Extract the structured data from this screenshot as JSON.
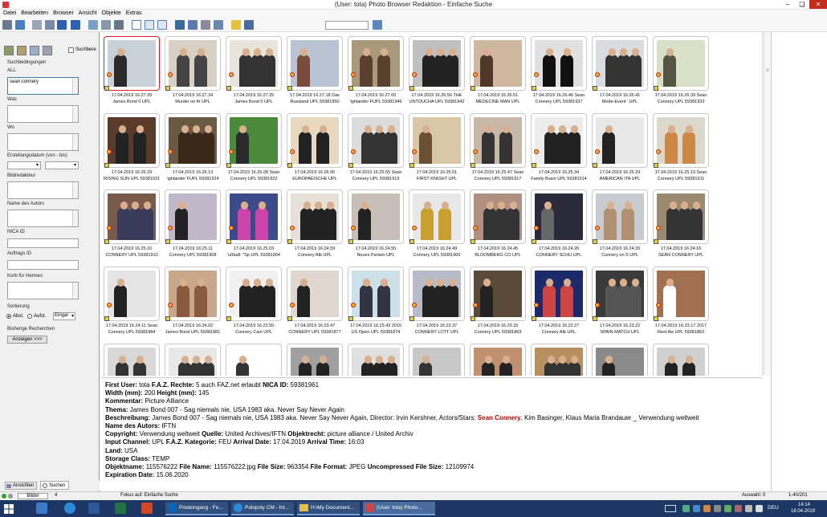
{
  "window": {
    "title": "(User: tota) Photo Browser Redaktion - Einfache Suche"
  },
  "menu": [
    "Datei",
    "Bearbeiten",
    "Browser",
    "Ansicht",
    "Objekte",
    "Extras"
  ],
  "search": {
    "chk_label": "Suchbere",
    "conditions_label": "Suchbedingungen",
    "all_label": "ALL",
    "all_value": "sean connery",
    "was": "Was",
    "wo": "Wo",
    "date": "Erstellungsdatum (von - bis)",
    "bildred": "Bildredakteur",
    "autor": "Name des Autors",
    "nica": "NICA ID",
    "auftrag": "Auftrags ID",
    "korb": "Korb für Hermes",
    "sort": "Sortierung",
    "abst": "Abst.",
    "aufst": "Aufst.",
    "eingang": "Eingar",
    "bisherige": "Bisherige Recherchen",
    "anzeigen": "Anzeigen >>>"
  },
  "tabs": {
    "ansichten": "Ansichten",
    "suchen": "Suchen"
  },
  "tiles": [
    {
      "d": "17.04.2019 16.27.39",
      "t": "James Bond 0 UPL"
    },
    {
      "d": "17.04.2019 16.27.34",
      "t": "Murder on th UPL"
    },
    {
      "d": "17.04.2019 16.27.25",
      "t": "James Bond 0 UPL"
    },
    {
      "d": "17.04.2019 16.27.18 Das",
      "t": "Russland UPL 59381950"
    },
    {
      "d": "17.04.2019 16.27.00",
      "t": "'ighlander FUPL 59381946"
    },
    {
      "d": "17.04.2019 16.26.56 THE",
      "t": "UNTOUCHA UPL 59381942"
    },
    {
      "d": "17.04.2019 16.26.51",
      "t": "MEDECINE MAN UPL"
    },
    {
      "d": "17.04.2019 16.26.46 Sean",
      "t": "Connery UPL 59381937"
    },
    {
      "d": "17.04.2019 16.26.41",
      "t": "Mode-Event ' UPL"
    },
    {
      "d": "17.04.2019 16.26.39 Sean",
      "t": "Connery UPL 59381933"
    },
    {
      "d": "17.04.2019 16.26.29",
      "t": "RISING SUN UPL 59381931"
    },
    {
      "d": "17.04.2019 16.26.13",
      "t": "'ighlander FUPL 59381924"
    },
    {
      "d": "17.04.2019 16.26.08 Sean",
      "t": "Connery UPL 59381922"
    },
    {
      "d": "17.04.2019 16.26.06",
      "t": "EUROPAEISCHE UPL"
    },
    {
      "d": "17.04.2019 16.25.55 Sean",
      "t": "Connery UPL 59381919"
    },
    {
      "d": "17.04.2019 16.25.51",
      "t": "FIRST KNIGHT UPL"
    },
    {
      "d": "17.04.2019 16.25.47 Sean",
      "t": "Connery UPL 59381917"
    },
    {
      "d": "17.04.2019 16.25.34",
      "t": "Family Busin UPL 59381914"
    },
    {
      "d": "17.04.2019 16.25.29",
      "t": "AMERICAN ITA UPL"
    },
    {
      "d": "17.04.2019 16.25.19 Sean",
      "t": "Connery UPL 59381911"
    },
    {
      "d": "17.04.2019 16.25.16",
      "t": "CONNERY UPL 59381910"
    },
    {
      "d": "17.04.2019 16.25.11",
      "t": "Connery UPL 59381908"
    },
    {
      "d": "17.04.2019 16.25.03",
      "t": "'ußball: \"Sp UPL 59381904"
    },
    {
      "d": "17.04.2019 16.24.59",
      "t": "Connery Alb UPL"
    },
    {
      "d": "17.04.2019 16.24.55",
      "t": "Neues Parlam UPL"
    },
    {
      "d": "17.04.2019 16.24.49",
      "t": "Connery UPL 59381900"
    },
    {
      "d": "17.04.2019 16.24.45",
      "t": "BLOOMBERG CO UPL"
    },
    {
      "d": "17.04.2019 16.24.26",
      "t": "CONNERY SCHU UPL"
    },
    {
      "d": "17.04.2019 16.24.20",
      "t": "Connery on S UPL"
    },
    {
      "d": "17.04.2019 16.24.16",
      "t": "SEAN CONNERY UPL"
    },
    {
      "d": "17.04.2019 16.24.11 Sean",
      "t": "Connery UPL 59381884"
    },
    {
      "d": "17.04.2019 16.24.02",
      "t": "James Bond UPL 59381881"
    },
    {
      "d": "17.04.2019 16.23.55",
      "t": "Connery Cain UPL"
    },
    {
      "d": "17.04.2019 16.23.47",
      "t": "CONNERY UPL 59381877"
    },
    {
      "d": "17.04.2019 16.23.43 2015",
      "t": "US Open UPL 59381874"
    },
    {
      "d": "17.04.2019 16.23.37",
      "t": "CONNERY LOTT UPL"
    },
    {
      "d": "17.04.2019 16.23.33",
      "t": "Connery UPL 59381869"
    },
    {
      "d": "17.04.2019 16.23.27",
      "t": "Connery Alb UPL"
    },
    {
      "d": "17.04.2019 16.23.22",
      "t": "SPAIN MATCH UPL"
    },
    {
      "d": "17.04.2019 16.23.17 2017",
      "t": "Reel Aw UPL 59381863"
    },
    {
      "d": "",
      "t": ""
    },
    {
      "d": "",
      "t": ""
    },
    {
      "d": "",
      "t": ""
    },
    {
      "d": "",
      "t": ""
    },
    {
      "d": "",
      "t": ""
    },
    {
      "d": "",
      "t": ""
    },
    {
      "d": "",
      "t": ""
    },
    {
      "d": "",
      "t": ""
    },
    {
      "d": "",
      "t": ""
    },
    {
      "d": "",
      "t": ""
    }
  ],
  "details": {
    "first_user_l": "First User:",
    "first_user": "tota",
    "rechte_l": "F.A.Z. Rechte:",
    "rechte": "5 auch FAZ.net erlaubt",
    "nica_l": "NICA ID:",
    "nica": "59381961",
    "width_l": "Width (mm):",
    "width": "200",
    "height_l": "Height (mm):",
    "height": "145",
    "komm_l": "Kommentar:",
    "komm": "Picture Alliance",
    "thema_l": "Thema:",
    "thema": "James Bond 007 - Sag niemals nie, USA 1983 aka. Never Say Never Again",
    "beschr_l": "Beschreibung:",
    "beschr_a": "James Bond 007 - Sag niemals nie, USA 1983 aka. Never Say Never Again, Director: Irvin Kershner, Actors/Stars:",
    "beschr_hl": "Sean Connery",
    "beschr_b": ", Kim Basinger, Klaus Maria Brandauer _ Verwendung weltweit",
    "autor_l": "Name des Autors:",
    "autor": "IFTN",
    "copy_l": "Copyright:",
    "copy": "Verwendung weltweit",
    "quelle_l": "Quelle:",
    "quelle": "United Archives/IFTN",
    "obj_l": "Objektrecht:",
    "obj": "picture alliance / United Archiv",
    "input_l": "Input Channel:",
    "input": "UPL",
    "kat_l": "F.A.Z. Kategorie:",
    "kat": "FEU",
    "arr_l": "Arrival Date:",
    "arr": "17.04.2019",
    "arrt_l": "Arrival Time:",
    "arrt": "16:03",
    "land_l": "Land:",
    "land": "USA",
    "storage_l": "Storage Class:",
    "storage": "TEMP",
    "objname_l": "Objektname:",
    "objname": "115576222",
    "fname_l": "File Name:",
    "fname": "115576222.jpg",
    "fsize_l": "File Size:",
    "fsize": "963354",
    "ffmt_l": "File Format:",
    "ffmt": "JPEG",
    "ufs_l": "Uncompressed File Size:",
    "ufs": "12109974",
    "exp_l": "Expiration Date:",
    "exp": "15.06.2020"
  },
  "status": {
    "bilder": "Bilder",
    "count": "4",
    "fokus": "Fokus auf: Einfache Suche",
    "auswahl": "Auswahl: 0",
    "range": "1-40/201"
  },
  "taskbar": {
    "t1": "Posteingang - Fe...",
    "t2": "Polopoly CM - Int...",
    "t3": "H:\\My Document...",
    "t4": "(User: tota) Photo...",
    "lang": "DEU",
    "time": "14:14",
    "date": "18.04.2019"
  },
  "colors": {
    "taskbar": "#1c3764",
    "highlight": "#c00000",
    "selected_border": "#e02020"
  }
}
